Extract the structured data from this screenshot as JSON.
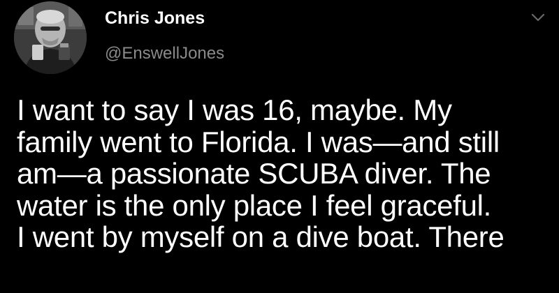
{
  "tweet": {
    "author": {
      "display_name": "Chris Jones",
      "handle": "@EnswellJones",
      "avatar_icon": "profile-photo-avatar"
    },
    "menu_icon": "chevron-down-icon",
    "text_lines": [
      "I want to say I was 16, maybe. My",
      "family went to Florida. I was—and still",
      "am—a passionate SCUBA diver. The",
      "water is the only place I feel graceful.",
      "I went by myself on a dive boat. There"
    ]
  },
  "colors": {
    "background": "#000000",
    "text_primary": "#ffffff",
    "text_secondary": "#8a8a8a"
  }
}
